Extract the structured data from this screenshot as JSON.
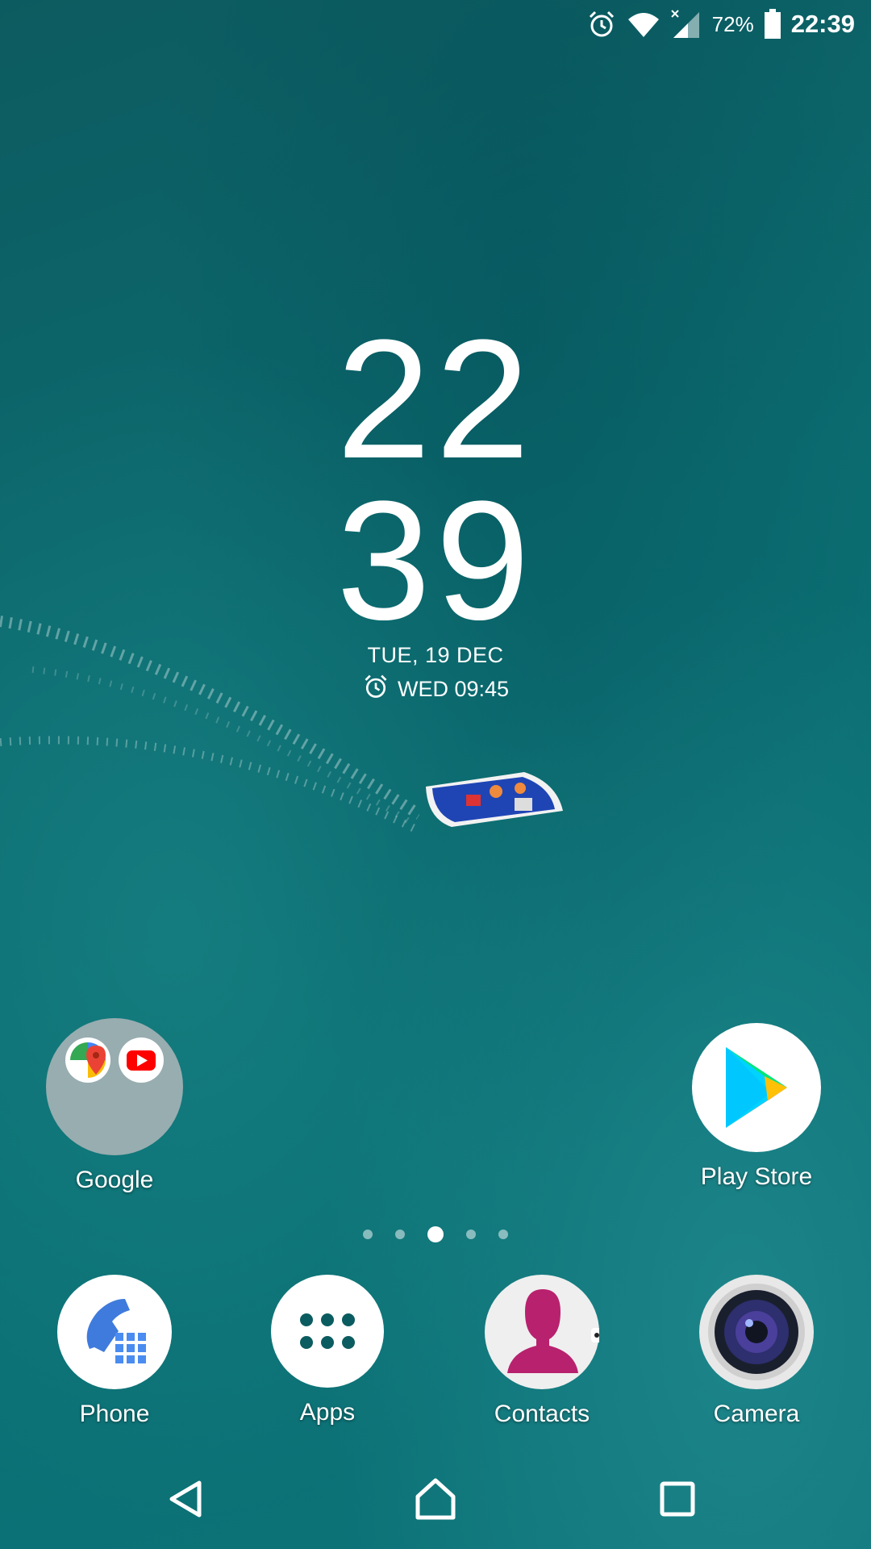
{
  "status_bar": {
    "icons": [
      "alarm-icon",
      "wifi-icon",
      "signal-icon",
      "battery-icon"
    ],
    "battery_percent": "72%",
    "time": "22:39"
  },
  "clock_widget": {
    "hours": "22",
    "minutes": "39",
    "date": "TUE, 19 DEC",
    "next_alarm": "WED 09:45"
  },
  "home_apps": [
    {
      "label": "Google",
      "icon": "google-folder-icon"
    },
    {
      "label": "Play Store",
      "icon": "play-store-icon"
    }
  ],
  "page_indicator": {
    "pages": 5,
    "current": 3
  },
  "dock": [
    {
      "label": "Phone",
      "icon": "phone-icon"
    },
    {
      "label": "Apps",
      "icon": "apps-grid-icon"
    },
    {
      "label": "Contacts",
      "icon": "contacts-icon"
    },
    {
      "label": "Camera",
      "icon": "camera-icon"
    }
  ],
  "nav_bar": [
    "back-icon",
    "home-icon",
    "recents-icon"
  ],
  "colors": {
    "wallpaper": "#0b6c70",
    "text": "#ffffff"
  }
}
